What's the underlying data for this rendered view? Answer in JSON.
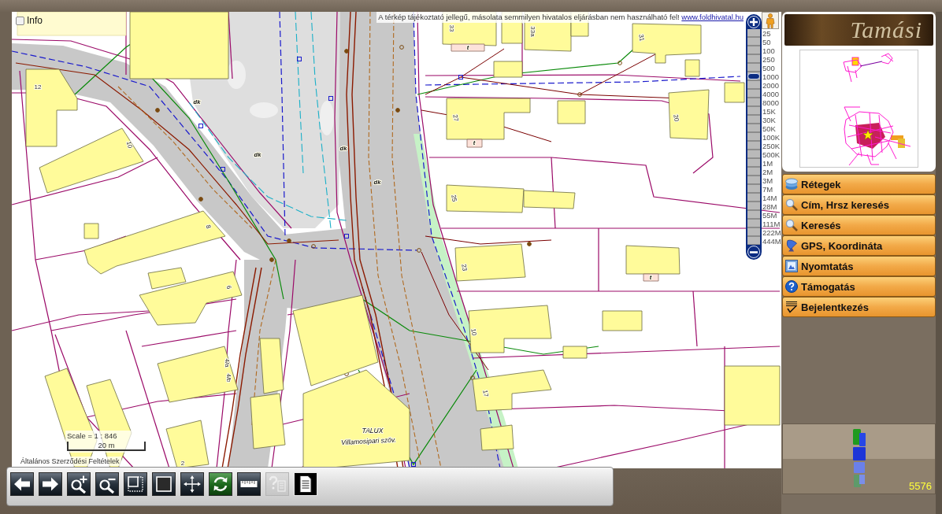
{
  "info": {
    "label": "Info",
    "checked": false
  },
  "disclaimer": {
    "text": "A térkép tájékoztató jellegű, másolata semmilyen hivatalos eljárásban nem használható fel!",
    "link": "www.foldhivatal.hu"
  },
  "zoom_slider": {
    "level": 0.78,
    "scales": [
      "25",
      "50",
      "100",
      "250",
      "500",
      "1000",
      "2000",
      "4000",
      "8000",
      "15K",
      "30K",
      "50K",
      "100K",
      "250K",
      "500K",
      "1M",
      "2M",
      "3M",
      "7M",
      "14M",
      "28M",
      "55M",
      "111M",
      "222M",
      "444M"
    ]
  },
  "map": {
    "labels": [
      {
        "text": "33",
        "kind": "number"
      },
      {
        "text": "33a",
        "kind": "number"
      },
      {
        "text": "31",
        "kind": "number"
      },
      {
        "text": "t",
        "kind": "mark"
      },
      {
        "text": "12",
        "kind": "number"
      },
      {
        "text": "10",
        "kind": "number"
      },
      {
        "text": "27",
        "kind": "number"
      },
      {
        "text": "t",
        "kind": "mark"
      },
      {
        "text": "20",
        "kind": "number"
      },
      {
        "text": "dk",
        "kind": "mark"
      },
      {
        "text": "dk",
        "kind": "mark"
      },
      {
        "text": "dk",
        "kind": "mark"
      },
      {
        "text": "dk",
        "kind": "mark"
      },
      {
        "text": "25",
        "kind": "number"
      },
      {
        "text": "8",
        "kind": "number"
      },
      {
        "text": "23",
        "kind": "number"
      },
      {
        "text": "t",
        "kind": "mark"
      },
      {
        "text": "6",
        "kind": "number"
      },
      {
        "text": "10",
        "kind": "number"
      },
      {
        "text": "4/a",
        "kind": "number"
      },
      {
        "text": "4/b",
        "kind": "number"
      },
      {
        "text": "17",
        "kind": "number"
      },
      {
        "text": "TALUX",
        "kind": "name"
      },
      {
        "text": "Villamosipari szöv.",
        "kind": "name"
      },
      {
        "text": "2",
        "kind": "number"
      }
    ],
    "scale": "Scale = 1 : 846",
    "scale_bar": "20 m",
    "terms_link": "Általános Szerződési Feltételek"
  },
  "logo": "Tamási",
  "menu": [
    {
      "label": "Rétegek",
      "kind": "layers"
    },
    {
      "label": "Cím, Hrsz keresés",
      "kind": "search"
    },
    {
      "label": "Keresés",
      "kind": "search"
    },
    {
      "label": "GPS, Koordináta",
      "kind": "gps"
    },
    {
      "label": "Nyomtatás",
      "kind": "print"
    },
    {
      "label": "Támogatás",
      "kind": "help"
    },
    {
      "label": "Bejelentkezés",
      "kind": "login"
    }
  ],
  "counter": "5576",
  "toolbar": [
    {
      "kind": "back",
      "disabled": false,
      "selected": false
    },
    {
      "kind": "forward",
      "disabled": false,
      "selected": false
    },
    {
      "kind": "zoomin",
      "disabled": false,
      "selected": false
    },
    {
      "kind": "zoomout",
      "disabled": false,
      "selected": false
    },
    {
      "kind": "zoombox",
      "disabled": false,
      "selected": false
    },
    {
      "kind": "fullextent",
      "disabled": false,
      "selected": false
    },
    {
      "kind": "pan",
      "disabled": false,
      "selected": false
    },
    {
      "kind": "refresh",
      "disabled": false,
      "selected": false
    },
    {
      "kind": "measure",
      "disabled": false,
      "selected": false
    },
    {
      "kind": "help",
      "disabled": true,
      "selected": false
    },
    {
      "kind": "document",
      "disabled": false,
      "selected": true
    }
  ]
}
